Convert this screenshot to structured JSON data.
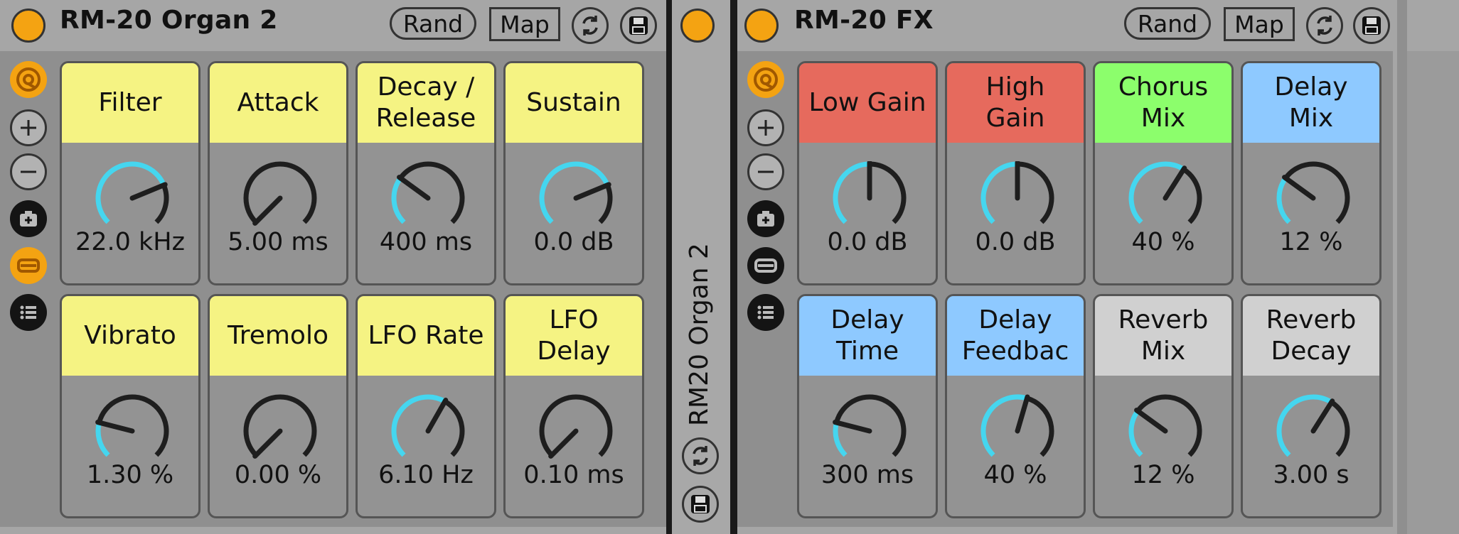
{
  "devices": [
    {
      "title": "RM-20 Organ 2",
      "rand_label": "Rand",
      "map_label": "Map",
      "macros": [
        {
          "label": "Filter",
          "value": "22.0 kHz",
          "color": "#f5f383",
          "fraction": 0.75
        },
        {
          "label": "Attack",
          "value": "5.00 ms",
          "color": "#f5f383",
          "fraction": 0.0
        },
        {
          "label": "Decay /\nRelease",
          "value": "400 ms",
          "color": "#f5f383",
          "fraction": 0.3
        },
        {
          "label": "Sustain",
          "value": "0.0 dB",
          "color": "#f5f383",
          "fraction": 0.75
        },
        {
          "label": "Vibrato",
          "value": "1.30 %",
          "color": "#f5f383",
          "fraction": 0.22
        },
        {
          "label": "Tremolo",
          "value": "0.00 %",
          "color": "#f5f383",
          "fraction": 0.0
        },
        {
          "label": "LFO Rate",
          "value": "6.10 Hz",
          "color": "#f5f383",
          "fraction": 0.61
        },
        {
          "label": "LFO\nDelay",
          "value": "0.10 ms",
          "color": "#f5f383",
          "fraction": 0.0
        }
      ]
    },
    {
      "title": "RM-20 FX",
      "rand_label": "Rand",
      "map_label": "Map",
      "macros": [
        {
          "label": "Low Gain",
          "value": "0.0 dB",
          "color": "#e66a5d",
          "fraction": 0.5
        },
        {
          "label": "High\nGain",
          "value": "0.0 dB",
          "color": "#e66a5d",
          "fraction": 0.5
        },
        {
          "label": "Chorus\nMix",
          "value": "40 %",
          "color": "#8cfe6c",
          "fraction": 0.62
        },
        {
          "label": "Delay\nMix",
          "value": "12 %",
          "color": "#8ec9ff",
          "fraction": 0.3
        },
        {
          "label": "Delay\nTime",
          "value": "300 ms",
          "color": "#8ec9ff",
          "fraction": 0.22
        },
        {
          "label": "Delay\nFeedbac",
          "value": "40 %",
          "color": "#8ec9ff",
          "fraction": 0.56
        },
        {
          "label": "Reverb\nMix",
          "value": "12 %",
          "color": "#d0d0d0",
          "fraction": 0.3
        },
        {
          "label": "Reverb\nDecay",
          "value": "3.00 s",
          "color": "#d0d0d0",
          "fraction": 0.62
        }
      ]
    }
  ],
  "rack_strip_title": "RM20 Organ 2",
  "colors": {
    "knob_arc": "#45d6ef",
    "knob_track": "#1e1e1e",
    "power_on": "#f4a312"
  }
}
